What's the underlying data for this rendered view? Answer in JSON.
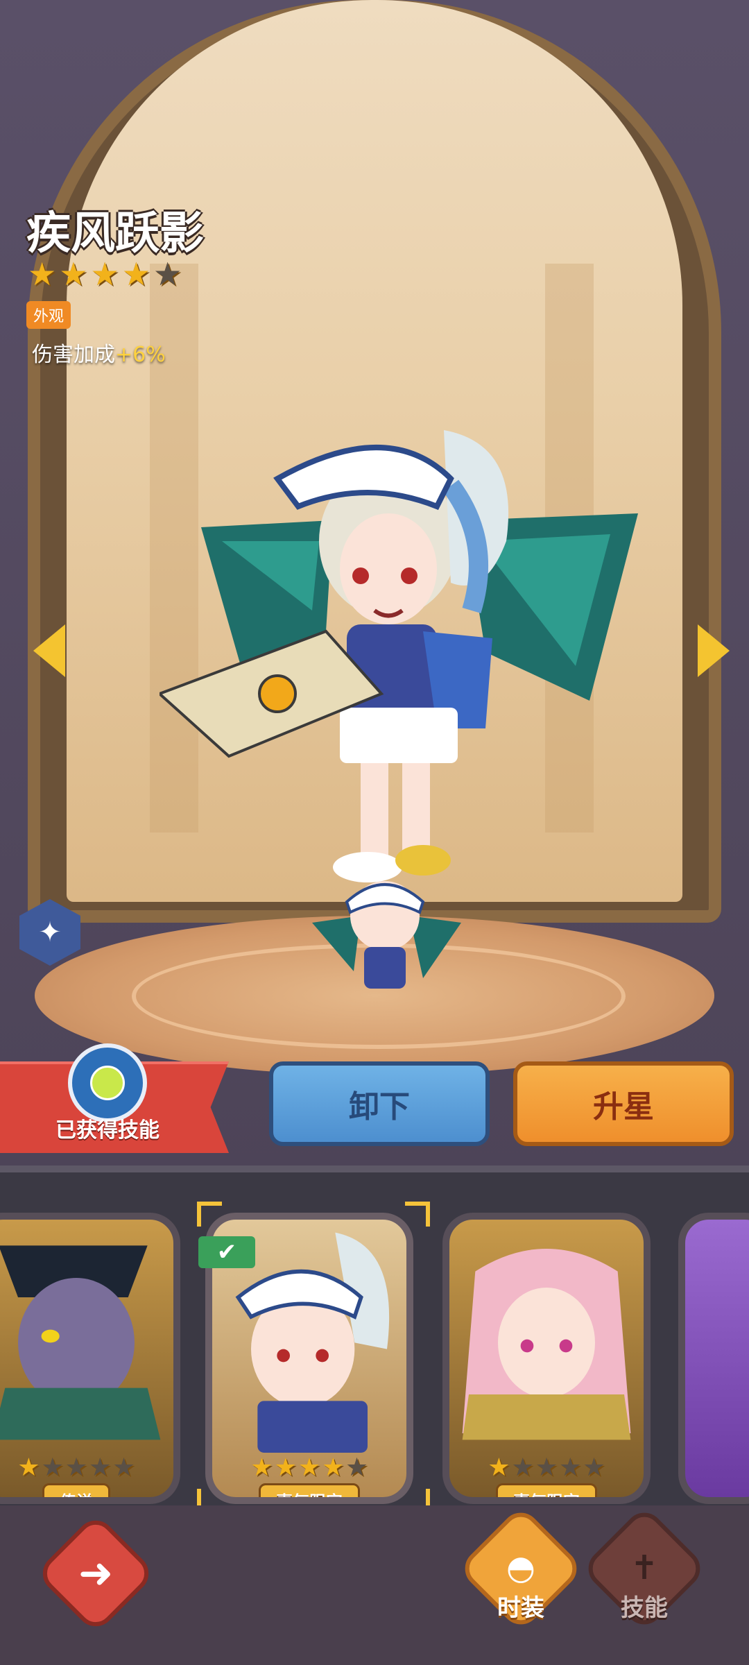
{
  "hero": {
    "name": "疾风跃影",
    "stars_filled": 4,
    "stars_total": 5,
    "tag": "外观",
    "bonus_label": "伤害加成",
    "bonus_value": "+6%"
  },
  "actions": {
    "skill_ribbon": "已获得技能",
    "unequip": "卸下",
    "upgrade_star": "升星"
  },
  "skins": [
    {
      "label": "传说",
      "stars_filled": 1,
      "stars_total": 5,
      "selected": false
    },
    {
      "label": "喜气限定",
      "stars_filled": 4,
      "stars_total": 5,
      "selected": true
    },
    {
      "label": "喜气限定",
      "stars_filled": 1,
      "stars_total": 5,
      "selected": false
    }
  ],
  "bottom_nav": {
    "costume": "时装",
    "skill": "技能"
  },
  "icons": {
    "back": "back-arrow-icon",
    "wing": "wing-icon",
    "check": "check-icon",
    "nav_costume": "hat-icon",
    "nav_skill": "sword-icon"
  },
  "colors": {
    "accent_gold": "#f4c430",
    "button_blue": "#5a9bd6",
    "button_orange": "#ef9a34",
    "ribbon_red": "#d9453b"
  }
}
